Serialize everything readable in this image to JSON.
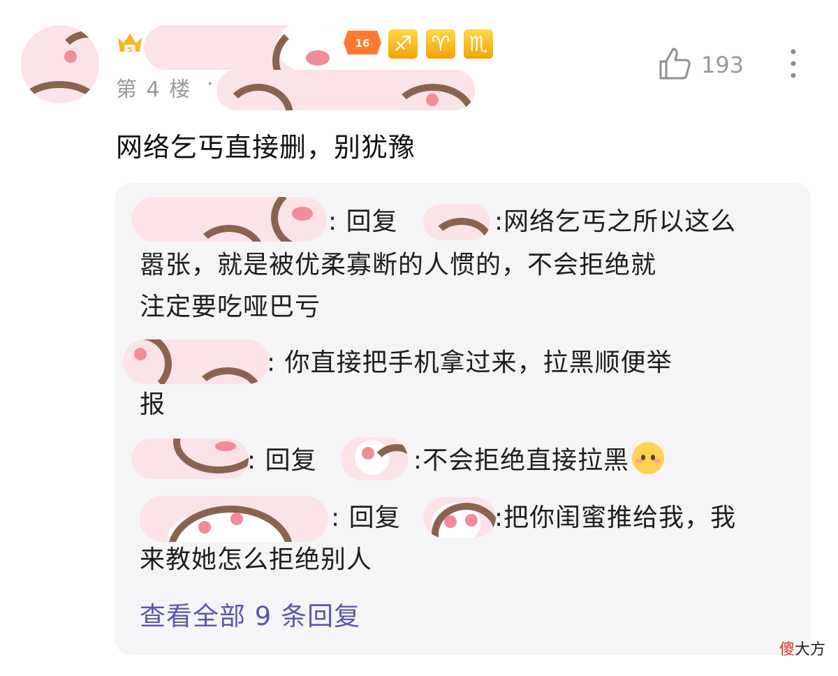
{
  "post": {
    "level_badge": "16",
    "zodiac_badges": [
      "♐",
      "♈",
      "♏"
    ],
    "floor_label": "第 4 楼",
    "floor_separator": "·",
    "like_count": "193",
    "comment_text": "网络乞丐直接删，别犹豫",
    "icons": {
      "like": "thumbs-up-icon",
      "more": "vertical-ellipsis-icon",
      "crown": "crown-badge-icon"
    }
  },
  "replies": [
    {
      "lines": [
        ":  回复",
        ":网络乞丐之所以这么",
        "嚣张，就是被优柔寡断的人惯的，不会拒绝就",
        "注定要吃哑巴亏"
      ]
    },
    {
      "lines": [
        ":  你直接把手机拿过来，拉黑顺便举",
        "报"
      ]
    },
    {
      "lines": [
        ":  回复",
        ":不会拒绝直接拉黑"
      ],
      "emoji": "blushing-face-icon"
    },
    {
      "lines": [
        ":  回复",
        ":把你闺蜜推给我，我",
        "来教她怎么拒绝别人"
      ]
    }
  ],
  "view_all_label": "查看全部 9 条回复",
  "watermark": {
    "red_char": "傻",
    "rest": "大方"
  },
  "colors": {
    "link": "#5b56a8",
    "reply_bg": "#f5f5f7",
    "muted": "#9a9a9a",
    "sticker_pink": "#fbe3e8"
  }
}
